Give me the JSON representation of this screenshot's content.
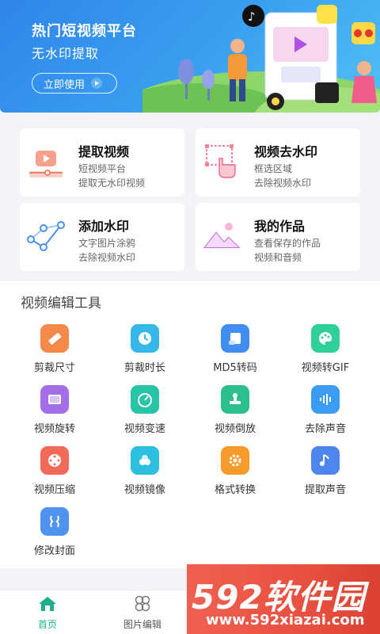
{
  "banner": {
    "title": "热门短视频平台",
    "subtitle": "无水印提取",
    "button": "立即使用"
  },
  "cards": [
    {
      "title": "提取视频",
      "line1": "短视频平台",
      "line2": "提取无水印视频",
      "icon": "extract-video-icon"
    },
    {
      "title": "视频去水印",
      "line1": "框选区域",
      "line2": "去除视频水印",
      "icon": "hand-select-icon"
    },
    {
      "title": "添加水印",
      "line1": "文字图片涂鸦",
      "line2": "去除视频水印",
      "icon": "pen-draw-icon"
    },
    {
      "title": "我的作品",
      "line1": "查看保存的作品",
      "line2": "视频和音频",
      "icon": "mountain-image-icon"
    }
  ],
  "tools_section": {
    "title": "视频编辑工具",
    "items": [
      {
        "label": "剪裁尺寸",
        "icon": "ruler-icon",
        "color": "#f5894a"
      },
      {
        "label": "剪裁时长",
        "icon": "clock-icon",
        "color": "#35b8e8"
      },
      {
        "label": "MD5转码",
        "icon": "scroll-icon",
        "color": "#3f8ef0"
      },
      {
        "label": "视频转GIF",
        "icon": "palette-icon",
        "color": "#2fcf9a"
      },
      {
        "label": "视频旋转",
        "icon": "tablet-icon",
        "color": "#a46ee8"
      },
      {
        "label": "视频变速",
        "icon": "speedometer-icon",
        "color": "#27c4a6"
      },
      {
        "label": "视频倒放",
        "icon": "stamp-icon",
        "color": "#2bbf8c"
      },
      {
        "label": "去除声音",
        "icon": "waveform-icon",
        "color": "#3a9cf2"
      },
      {
        "label": "视频压缩",
        "icon": "film-reel-icon",
        "color": "#f26a5a"
      },
      {
        "label": "视频镜像",
        "icon": "circles-icon",
        "color": "#2cbfe0"
      },
      {
        "label": "格式转换",
        "icon": "gear-icon",
        "color": "#f79a2a"
      },
      {
        "label": "提取声音",
        "icon": "music-note-icon",
        "color": "#4e86ee"
      },
      {
        "label": "修改封面",
        "icon": "cover-icon",
        "color": "#4f93ee"
      }
    ]
  },
  "nav": {
    "home": "首页",
    "image_edit": "图片编辑"
  },
  "watermark": {
    "logo": "592软件园",
    "url": "www.592xiazai.com"
  },
  "colors": {
    "accent": "#2f86e8",
    "nav_active": "#1fae8a"
  }
}
